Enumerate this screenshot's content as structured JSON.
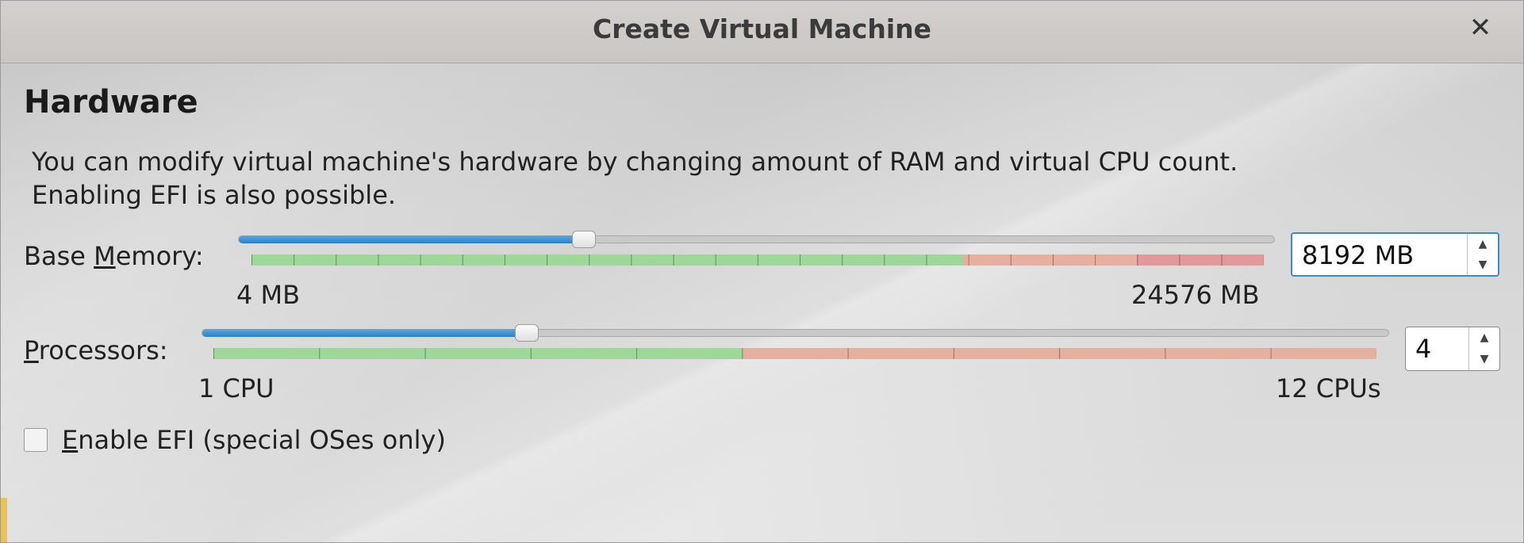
{
  "window": {
    "title": "Create Virtual Machine",
    "close_glyph": "✕"
  },
  "hardware": {
    "title": "Hardware",
    "description": "You can modify virtual machine's hardware by changing amount of RAM and virtual CPU count. Enabling EFI is also possible."
  },
  "memory": {
    "label_pre": "Base ",
    "label_mnemonic": "M",
    "label_post": "emory:",
    "min_label": "4 MB",
    "max_label": "24576 MB",
    "value": "8192 MB",
    "slider_fraction": 0.333
  },
  "processors": {
    "label_mnemonic": "P",
    "label_post": "rocessors:",
    "min_label": "1 CPU",
    "max_label": "12 CPUs",
    "value": "4",
    "slider_fraction": 0.273
  },
  "efi": {
    "label_mnemonic": "E",
    "label_post": "nable EFI (special OSes only)",
    "checked": false
  },
  "icons": {
    "spin_up": "▲",
    "spin_down": "▼"
  },
  "colors": {
    "slider_fill": "#2f7fc2",
    "range_ok": "#9fd69a",
    "range_warn": "#e5b0a0",
    "range_bad": "#e19a9c",
    "focus": "#3b8bd0"
  }
}
